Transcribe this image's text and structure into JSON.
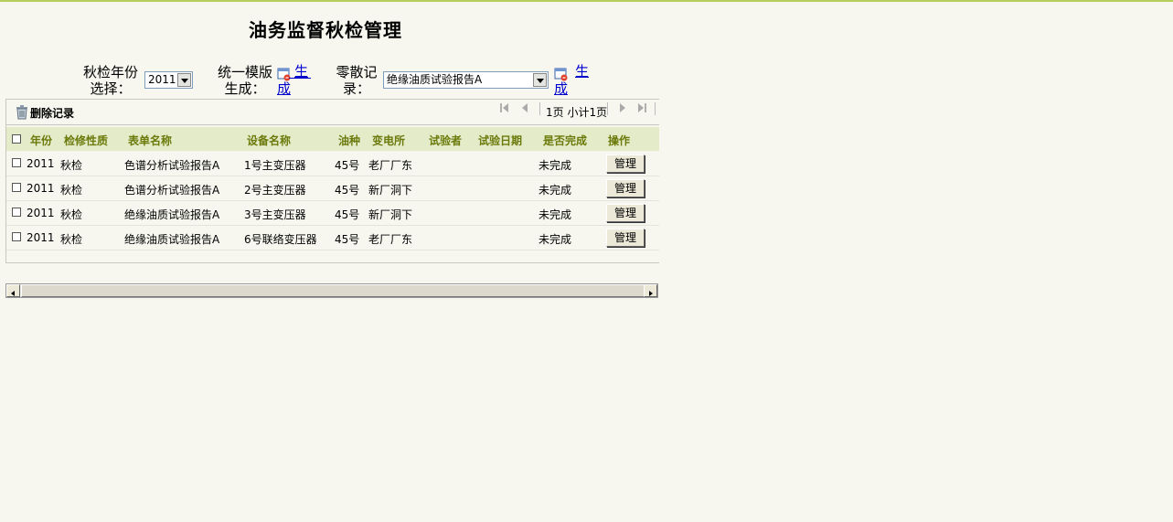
{
  "page": {
    "title": "油务监督秋检管理"
  },
  "filters": {
    "year_label_1": "秋检年份",
    "year_label_2": "选择：",
    "year_value": "2011",
    "template_label_1": "统一模版",
    "template_label_2": "生成：",
    "template_gen_link_1": "生",
    "template_gen_link_2": "成",
    "scattered_label_1": "零散记",
    "scattered_label_2": "录：",
    "scattered_value": "绝缘油质试验报告A",
    "scattered_gen_link_1": "生",
    "scattered_gen_link_2": "成"
  },
  "toolbar": {
    "delete_label": "删除记录",
    "pager_text": "1页 小计1页"
  },
  "table": {
    "headers": [
      "年份",
      "检修性质",
      "表单名称",
      "设备名称",
      "油种",
      "变电所",
      "试验者",
      "试验日期",
      "是否完成",
      "操作"
    ],
    "rows": [
      {
        "year": "2011",
        "type": "秋检",
        "form": "色谱分析试验报告A",
        "device": "1号主变压器",
        "oil": "45号",
        "station": "老厂厂东",
        "tester": "",
        "date": "",
        "done": "未完成",
        "action": "管理"
      },
      {
        "year": "2011",
        "type": "秋检",
        "form": "色谱分析试验报告A",
        "device": "2号主变压器",
        "oil": "45号",
        "station": "新厂洞下",
        "tester": "",
        "date": "",
        "done": "未完成",
        "action": "管理"
      },
      {
        "year": "2011",
        "type": "秋检",
        "form": "绝缘油质试验报告A",
        "device": "3号主变压器",
        "oil": "45号",
        "station": "新厂洞下",
        "tester": "",
        "date": "",
        "done": "未完成",
        "action": "管理"
      },
      {
        "year": "2011",
        "type": "秋检",
        "form": "绝缘油质试验报告A",
        "device": "6号联络变压器",
        "oil": "45号",
        "station": "老厂厂东",
        "tester": "",
        "date": "",
        "done": "未完成",
        "action": "管理"
      }
    ]
  },
  "icons": {
    "generate": "calendar-generate-icon",
    "delete": "trash-icon",
    "pager_first": "first-page-icon",
    "pager_prev": "prev-page-icon",
    "pager_next": "next-page-icon",
    "pager_last": "last-page-icon"
  },
  "colors": {
    "header_bg": "#e4ebc9",
    "header_text": "#6b7a0a",
    "top_line": "#b7cf5a",
    "page_bg": "#f7f7f0"
  }
}
